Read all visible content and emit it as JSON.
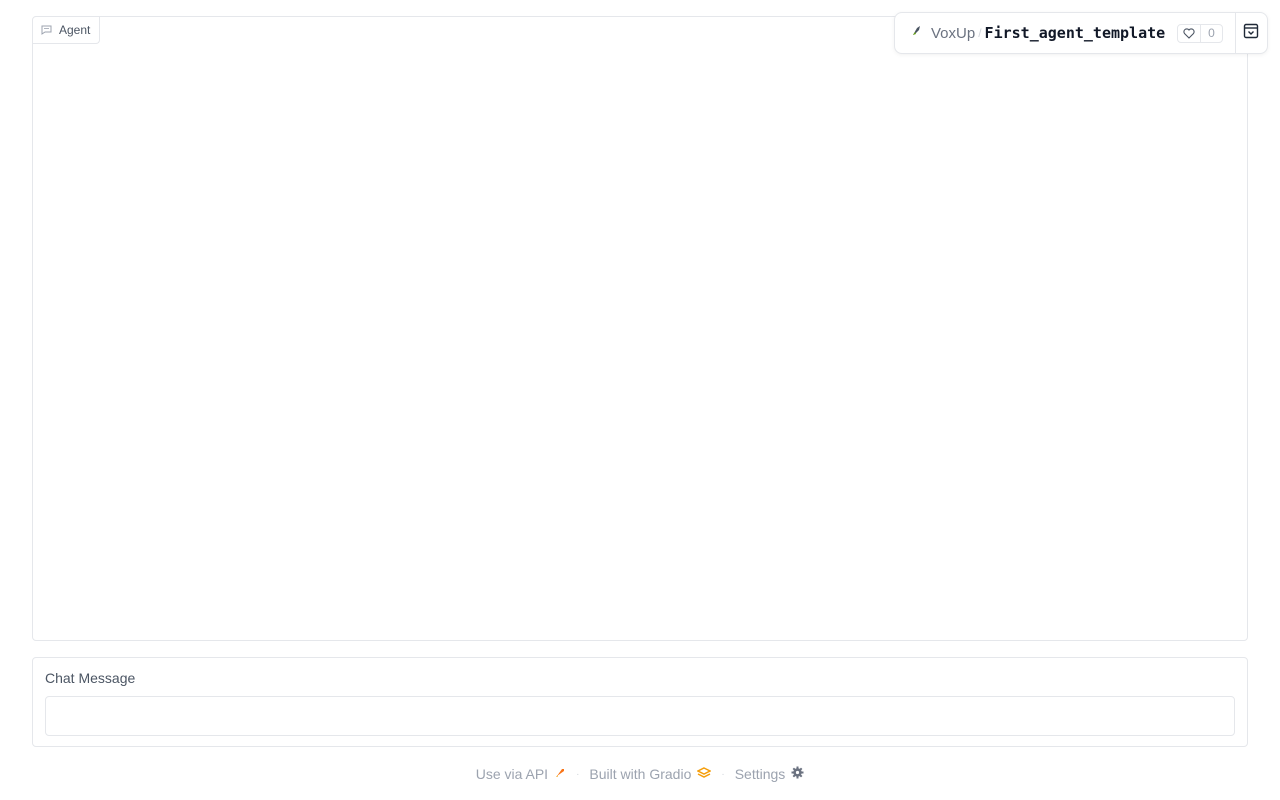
{
  "chatbot": {
    "label": "Agent",
    "messages": []
  },
  "space_badge": {
    "owner": "VoxUp",
    "separator": "/",
    "repo": "First_agent_template",
    "likes": "0"
  },
  "input": {
    "label": "Chat Message",
    "value": "",
    "placeholder": ""
  },
  "footer": {
    "api_label": "Use via API",
    "built_with_label": "Built with Gradio",
    "settings_label": "Settings",
    "separator": "·"
  },
  "colors": {
    "gradio_orange": "#f59e0b",
    "border": "#e5e7eb"
  }
}
